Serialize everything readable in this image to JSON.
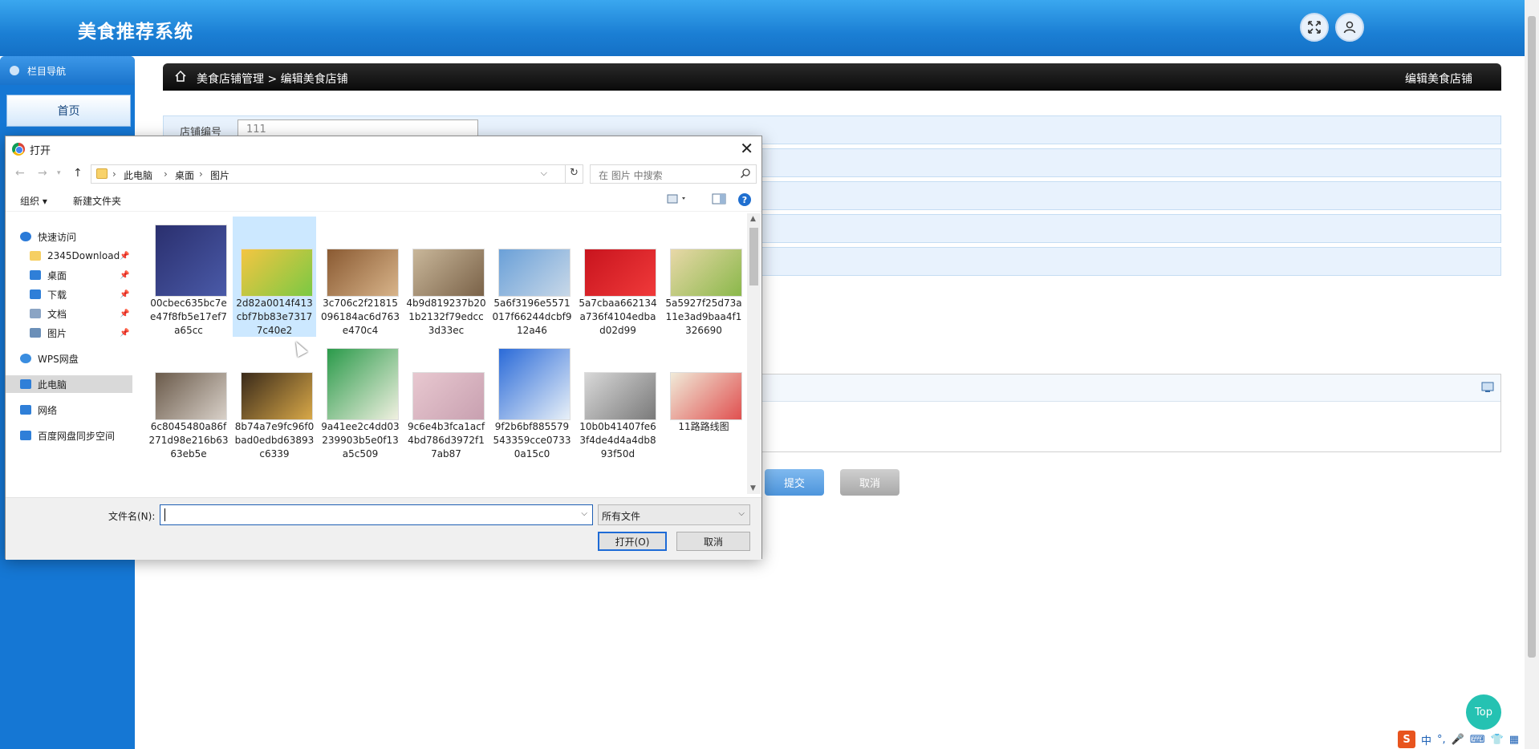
{
  "app": {
    "title": "美食推荐系统"
  },
  "header": {
    "fullscreen_icon": "fullscreen-icon",
    "user_icon": "user-icon"
  },
  "sidebar": {
    "nav_title": "栏目导航",
    "home": "首页"
  },
  "breadcrumb": {
    "path": "美食店铺管理 > 编辑美食店铺",
    "page_title": "编辑美食店铺"
  },
  "form": {
    "shop_no_label": "店铺编号",
    "shop_no_value": "111",
    "submit": "提交",
    "cancel": "取消"
  },
  "top_button": "Top",
  "ime": {
    "logo": "S",
    "lang": "中"
  },
  "dialog": {
    "title": "打开",
    "address": {
      "segments": [
        "此电脑",
        "桌面",
        "图片"
      ]
    },
    "search_placeholder": "在 图片 中搜索",
    "toolbar": {
      "organize": "组织 ▾",
      "new_folder": "新建文件夹",
      "help": "?"
    },
    "nav": [
      {
        "label": "快速访问",
        "icon": "star-icon",
        "color": "#2a7ad8"
      },
      {
        "label": "2345Download",
        "icon": "folder-icon",
        "color": "#f6cf62",
        "pinned": true
      },
      {
        "label": "桌面",
        "icon": "desktop-icon",
        "color": "#2f7fd8",
        "pinned": true
      },
      {
        "label": "下载",
        "icon": "download-icon",
        "color": "#2f7fd8",
        "pinned": true
      },
      {
        "label": "文档",
        "icon": "document-icon",
        "color": "#8aa4c4",
        "pinned": true
      },
      {
        "label": "图片",
        "icon": "pictures-icon",
        "color": "#6b8fb8",
        "pinned": true
      },
      {
        "label": "WPS网盘",
        "icon": "cloud-icon",
        "color": "#3a8de0"
      },
      {
        "label": "此电脑",
        "icon": "computer-icon",
        "color": "#2f7fd8",
        "selected": true
      },
      {
        "label": "网络",
        "icon": "network-icon",
        "color": "#2f7fd8"
      },
      {
        "label": "百度网盘同步空间",
        "icon": "baidu-cloud-icon",
        "color": "#2f7fd8"
      }
    ],
    "files": [
      {
        "name": "00cbec635bc7ee47f8fb5e17ef7a65cc",
        "thumb": "handbag",
        "colors": [
          "#2a2f6e",
          "#4a5aa8"
        ]
      },
      {
        "name": "2d82a0014f413cbf7bb83e73177c40e2",
        "thumb": "abcd",
        "colors": [
          "#f4c542",
          "#7ac943"
        ],
        "selected": true
      },
      {
        "name": "3c706c2f21815096184ac6d763e470c4",
        "thumb": "hotel-room",
        "colors": [
          "#8a5a32",
          "#d8b48a"
        ]
      },
      {
        "name": "4b9d819237b201b2132f79edcc3d33ec",
        "thumb": "coins",
        "colors": [
          "#c9b79a",
          "#7a6248"
        ]
      },
      {
        "name": "5a6f3196e5571017f66244dcbf912a46",
        "thumb": "building",
        "colors": [
          "#6aa0d8",
          "#c8d8e8"
        ]
      },
      {
        "name": "5a7cbaa662134a736f4104edbad02d99",
        "thumb": "red-banner",
        "colors": [
          "#c8141e",
          "#f03a3a"
        ]
      },
      {
        "name": "5a5927f25d73a11e3ad9baa4f1326690",
        "thumb": "rolls",
        "colors": [
          "#e8d8a8",
          "#8ab84a"
        ]
      },
      {
        "name": "6c8045480a86f271d98e216b6363eb5e",
        "thumb": "bedroom",
        "colors": [
          "#6a5a4a",
          "#d8d0c8"
        ]
      },
      {
        "name": "8b74a7e9fc96f0bad0edbd63893c6339",
        "thumb": "movie-poster",
        "colors": [
          "#3a2a1a",
          "#d8a848"
        ]
      },
      {
        "name": "9a41ee2c4dd03239903b5e0f13a5c509",
        "thumb": "medicine-box",
        "colors": [
          "#2a9a4a",
          "#f0f0e0"
        ]
      },
      {
        "name": "9c6e4b3fca1acf4bd786d3972f17ab87",
        "thumb": "cosmetics",
        "colors": [
          "#e8c8d0",
          "#c8a0b0"
        ]
      },
      {
        "name": "9f2b6bf885579543359cce07330a15c0",
        "thumb": "water-bottle",
        "colors": [
          "#2a6ad8",
          "#e8f0f8"
        ]
      },
      {
        "name": "10b0b41407fe63f4de4d4a4db893f50d",
        "thumb": "wedding",
        "colors": [
          "#d8d8d8",
          "#7a7a7a"
        ]
      },
      {
        "name": "11路路线图",
        "thumb": "map",
        "colors": [
          "#f0ead8",
          "#e05050"
        ]
      },
      {
        "name": "",
        "thumb": "phones",
        "colors": [
          "#3a3a3a",
          "#a07ac8"
        ]
      },
      {
        "name": "",
        "thumb": "dining",
        "colors": [
          "#d8c8b8",
          "#a89078"
        ]
      },
      {
        "name": "",
        "thumb": "painting",
        "colors": [
          "#e8eef8",
          "#6a8ab8"
        ]
      },
      {
        "name": "",
        "thumb": "dark-scene",
        "colors": [
          "#1a1a1a",
          "#5a4a3a"
        ]
      },
      {
        "name": "",
        "thumb": "portrait",
        "colors": [
          "#2a3a5a",
          "#e8c8a8"
        ]
      },
      {
        "name": "",
        "thumb": "recycle",
        "colors": [
          "#ffffff",
          "#2a9a4a"
        ]
      },
      {
        "name": "",
        "thumb": "girl",
        "colors": [
          "#c89a6a",
          "#f8e8d8"
        ]
      }
    ],
    "filename_label": "文件名(N):",
    "filename_value": "",
    "filetype": "所有文件",
    "open": "打开(O)",
    "cancel": "取消"
  }
}
